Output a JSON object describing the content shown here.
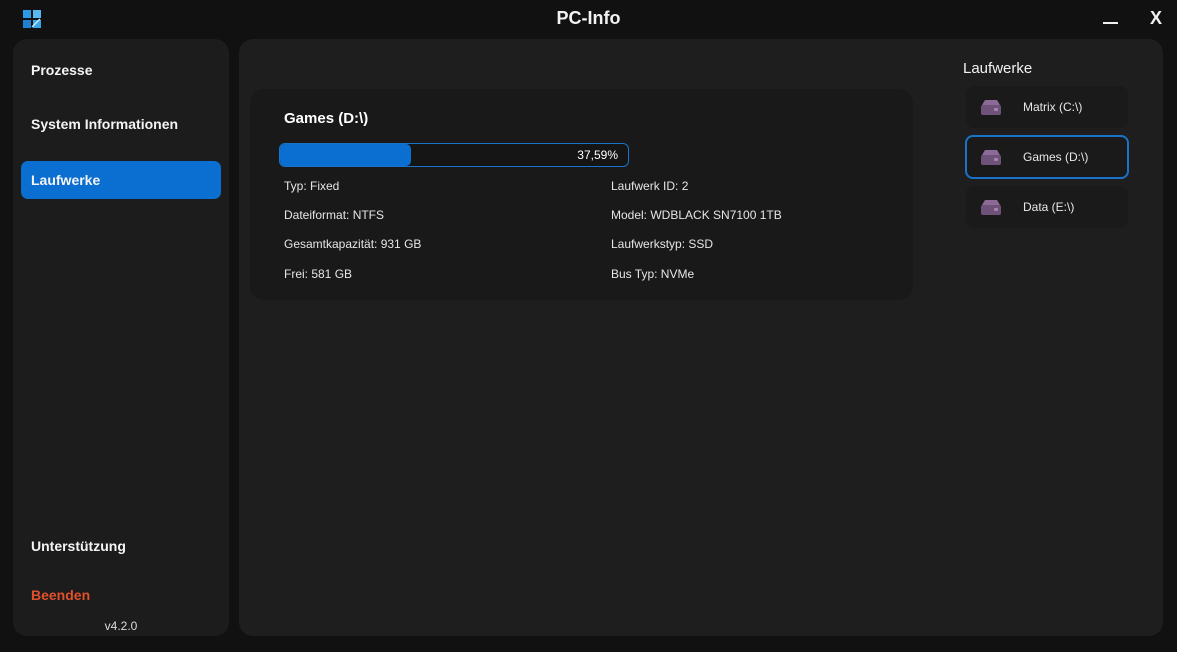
{
  "window": {
    "title": "PC-Info",
    "close_label": "X"
  },
  "sidebar": {
    "items": [
      {
        "label": "Prozesse"
      },
      {
        "label": "System Informationen"
      },
      {
        "label": "Laufwerke",
        "active": true
      }
    ],
    "support_label": "Unterstützung",
    "exit_label": "Beenden",
    "version": "v4.2.0"
  },
  "drive_details": {
    "title": "Games (D:\\)",
    "usage_percent": 37.59,
    "usage_label": "37,59%",
    "left": [
      "Typ: Fixed",
      "Dateiformat: NTFS",
      "Gesamtkapazität: 931 GB",
      "Frei: 581 GB"
    ],
    "right": [
      "Laufwerk ID: 2",
      "Model: WDBLACK SN7100 1TB",
      "Laufwerkstyp: SSD",
      "Bus Typ: NVMe"
    ]
  },
  "drives_panel": {
    "title": "Laufwerke",
    "items": [
      {
        "label": "Matrix (C:\\)",
        "icon": "drive-icon"
      },
      {
        "label": "Games (D:\\)",
        "icon": "drive-icon",
        "selected": true
      },
      {
        "label": "Data (E:\\)",
        "icon": "drive-icon"
      }
    ]
  },
  "colors": {
    "accent": "#0a6fd0",
    "exit": "#e0502c",
    "drive_icon": "#7b5a86"
  }
}
